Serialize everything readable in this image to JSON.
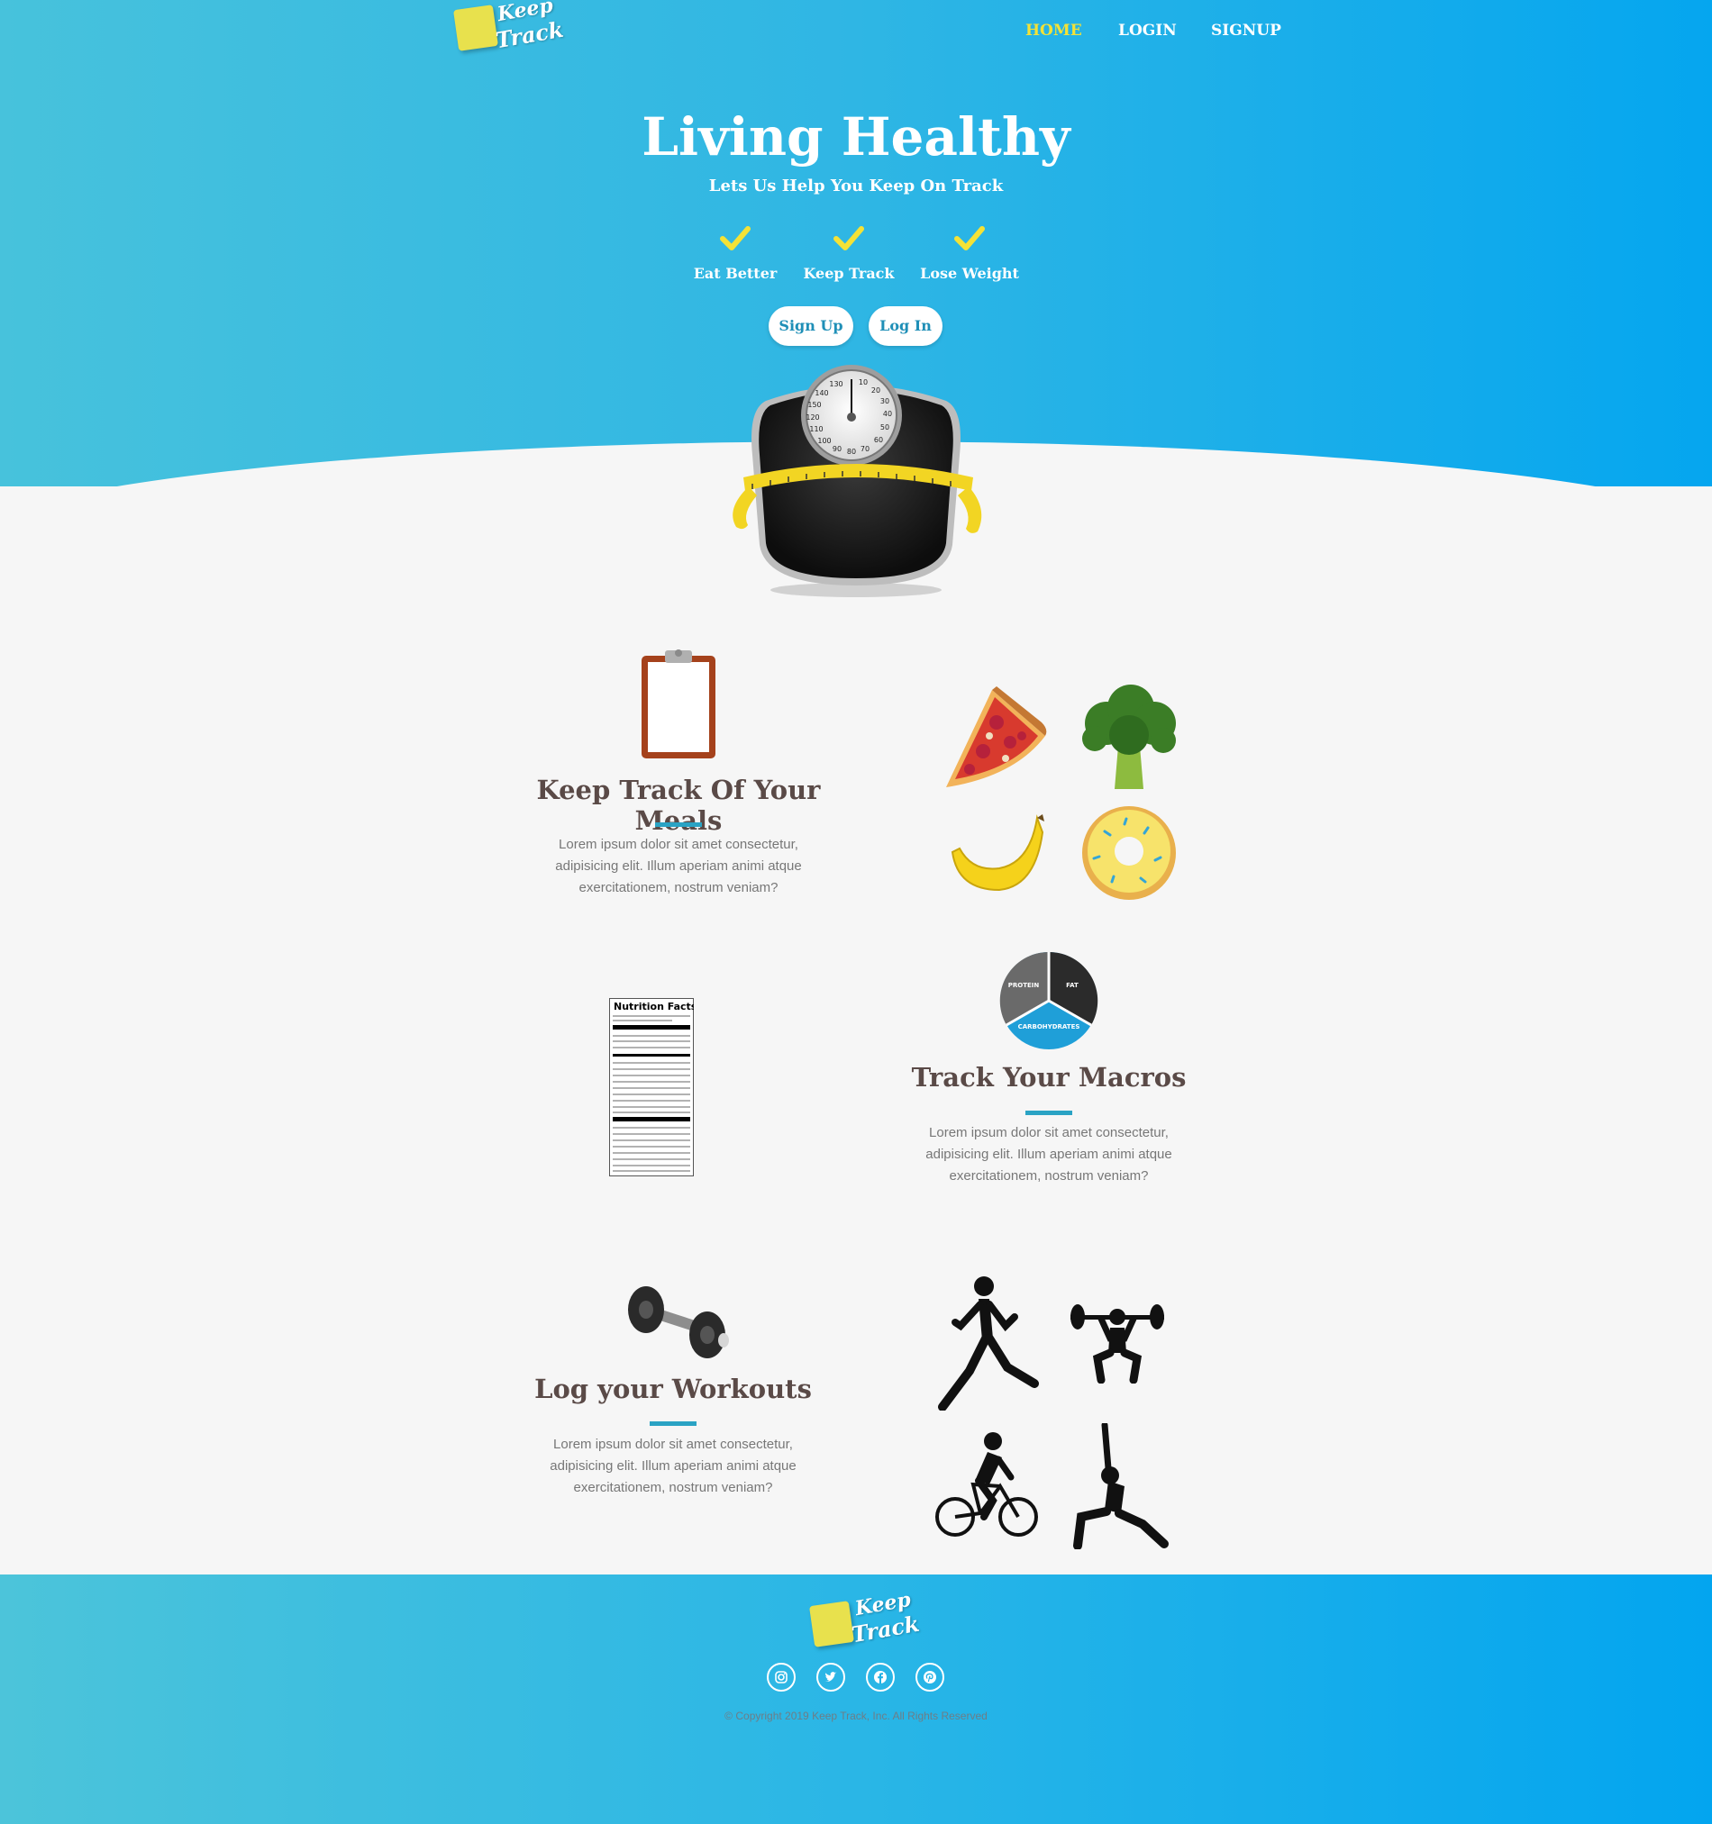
{
  "header": {
    "logo_line1": "Keep",
    "logo_line2": "Track",
    "nav": [
      {
        "label": "HOME"
      },
      {
        "label": "LOGIN"
      },
      {
        "label": "SIGNUP"
      }
    ]
  },
  "hero": {
    "title": "Living Healthy",
    "subtitle": "Lets Us Help You Keep On Track",
    "features": [
      {
        "label": "Eat Better"
      },
      {
        "label": "Keep Track"
      },
      {
        "label": "Lose Weight"
      }
    ],
    "signup_label": "Sign Up",
    "login_label": "Log In"
  },
  "sections": {
    "meals": {
      "title": "Keep Track Of Your Meals",
      "text": "Lorem ipsum dolor sit amet consectetur, adipisicing elit. Illum aperiam animi atque exercitationem, nostrum veniam?"
    },
    "macros": {
      "title": "Track Your Macros",
      "text": "Lorem ipsum dolor sit amet consectetur, adipisicing elit. Illum aperiam animi atque exercitationem, nostrum veniam?",
      "labels": {
        "protein": "PROTEIN",
        "fat": "FAT",
        "carbs": "CARBOHYDRATES"
      }
    },
    "workouts": {
      "title": "Log your Workouts",
      "text": "Lorem ipsum dolor sit amet consectetur, adipisicing elit. Illum aperiam animi atque exercitationem, nostrum veniam?"
    }
  },
  "nutrition_label": {
    "heading": "Nutrition Facts"
  },
  "scale": {
    "dial_numbers": [
      "130",
      "140",
      "150",
      "10",
      "20",
      "30",
      "40",
      "50",
      "60",
      "70",
      "80",
      "90",
      "100",
      "110",
      "120"
    ]
  },
  "footer": {
    "copyright": "© Copyright 2019 Keep Track, Inc. All Rights Reserved",
    "social": [
      {
        "icon": "instagram-icon"
      },
      {
        "icon": "twitter-icon"
      },
      {
        "icon": "facebook-icon"
      },
      {
        "icon": "pinterest-icon"
      }
    ]
  },
  "colors": {
    "accent": "#f4e236",
    "hero_start": "#47c2dc",
    "hero_end": "#05a6ef",
    "underline": "#2aa3c4",
    "heading": "#5a4a47"
  }
}
